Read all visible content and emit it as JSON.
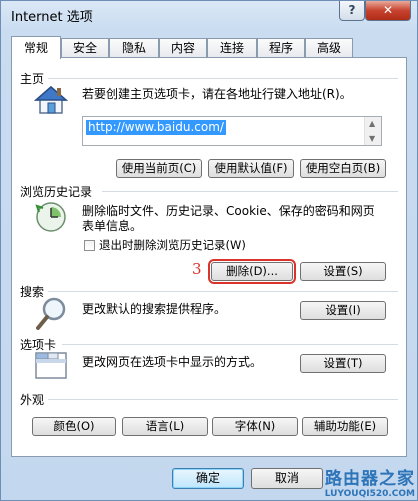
{
  "window": {
    "title": "Internet 选项",
    "help": "?",
    "close": "✕"
  },
  "tabs": [
    "常规",
    "安全",
    "隐私",
    "内容",
    "连接",
    "程序",
    "高级"
  ],
  "homepage": {
    "label": "主页",
    "description": "若要创建主页选项卡，请在各地址行键入地址(R)。",
    "url": "http://www.baidu.com/",
    "buttons": [
      "使用当前页(C)",
      "使用默认值(F)",
      "使用空白页(B)"
    ]
  },
  "history": {
    "label": "浏览历史记录",
    "description_line1": "删除临时文件、历史记录、Cookie、保存的密码和网页",
    "description_line2": "表单信息。",
    "checkbox_label": "退出时删除浏览历史记录(W)",
    "step_marker": "3",
    "delete_button": "删除(D)...",
    "settings_button": "设置(S)"
  },
  "search": {
    "label": "搜索",
    "description": "更改默认的搜索提供程序。",
    "settings_button": "设置(I)"
  },
  "tabs_section": {
    "label": "选项卡",
    "description": "更改网页在选项卡中显示的方式。",
    "settings_button": "设置(T)"
  },
  "appearance": {
    "label": "外观",
    "buttons": [
      "颜色(O)",
      "语言(L)",
      "字体(N)",
      "辅助功能(E)"
    ]
  },
  "footer": {
    "ok": "确定",
    "cancel": "取消"
  },
  "watermark": {
    "line1": "路由器之家",
    "line2": "LUYOUQI520.COM"
  }
}
